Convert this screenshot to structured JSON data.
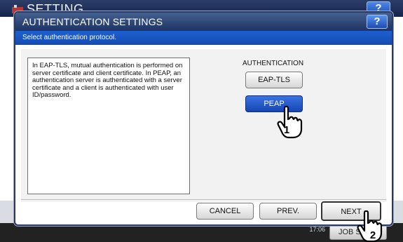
{
  "background": {
    "title": "SETTING",
    "help_label": "?",
    "time": "17:06",
    "job_status_label": "JOB S"
  },
  "dialog": {
    "title": "AUTHENTICATION SETTINGS",
    "help_label": "?",
    "instruction": "Select authentication protocol.",
    "description": "In EAP-TLS, mutual authentication is performed on server certificate and client certificate. In PEAP, an authentication server is authenticated with a server certificate and a client is authenticated with user ID/password.",
    "authentication_label": "AUTHENTICATION",
    "options": [
      {
        "label": "EAP-TLS",
        "selected": false
      },
      {
        "label": "PEAP",
        "selected": true
      }
    ],
    "footer": {
      "cancel_label": "CANCEL",
      "prev_label": "PREV.",
      "next_label": "NEXT"
    }
  },
  "callouts": {
    "step1": "1",
    "step2": "2"
  },
  "colors": {
    "title_bar": "#1e3363",
    "subbar_blue": "#1d5fcf",
    "selected_button": "#1546b4"
  }
}
